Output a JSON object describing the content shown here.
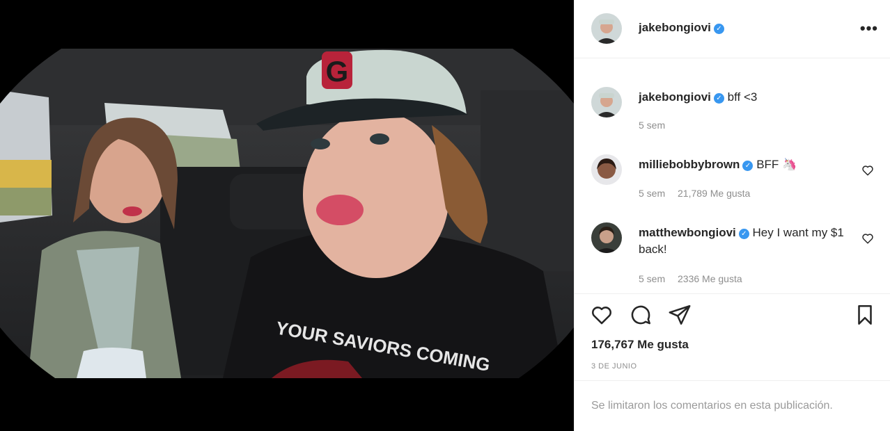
{
  "post": {
    "username": "jakebongiovi",
    "verified": true,
    "caption": "bff <3",
    "caption_time": "5 sem",
    "more_icon": "more-horizontal-icon",
    "likes": "176,767 Me gusta",
    "date": "3 DE JUNIO",
    "comments_limited": "Se limitaron los comentarios en esta publicación."
  },
  "photo": {
    "shirt_text": "YOUR SAVIORS COMING",
    "cap_logo": "G"
  },
  "comments": [
    {
      "username": "milliebobbybrown",
      "verified": true,
      "text": "BFF 🦄",
      "time": "5 sem",
      "likes": "21,789 Me gusta"
    },
    {
      "username": "matthewbongiovi",
      "verified": true,
      "text": "Hey I want my $1 back!",
      "time": "5 sem",
      "likes": "2336 Me gusta"
    }
  ],
  "icons": {
    "like": "heart-icon",
    "comment": "comment-icon",
    "share": "share-icon",
    "save": "bookmark-icon",
    "verified": "verified-badge-icon"
  },
  "colors": {
    "verified_blue": "#3897f0",
    "secondary_text": "#8e8e8e"
  }
}
